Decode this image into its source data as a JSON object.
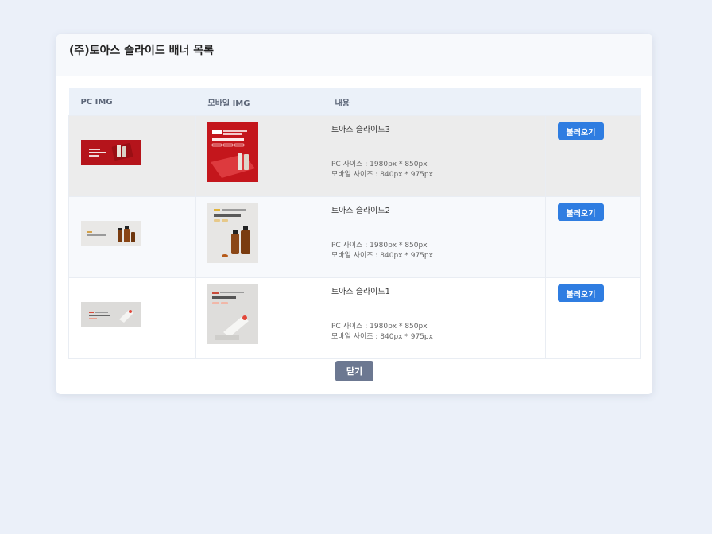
{
  "modal": {
    "title": "(주)토아스 슬라이드 배너 목록",
    "close_label": "닫기"
  },
  "table": {
    "headers": [
      "PC IMG",
      "모바일 IMG",
      "내용",
      ""
    ],
    "rows": [
      {
        "name": "토아스 슬라이드3",
        "pc_size": "PC 사이즈 : 1980px * 850px",
        "mobile_size": "모바일 사이즈 : 840px * 975px",
        "button": "불러오기"
      },
      {
        "name": "토아스 슬라이드2",
        "pc_size": "PC 사이즈 : 1980px * 850px",
        "mobile_size": "모바일 사이즈 : 840px * 975px",
        "button": "불러오기"
      },
      {
        "name": "토아스 슬라이드1",
        "pc_size": "PC 사이즈 : 1980px * 850px",
        "mobile_size": "모바일 사이즈 : 840px * 975px",
        "button": "불러오기"
      }
    ]
  },
  "colors": {
    "background": "#ebf0f9",
    "primary_button": "#2f7de1",
    "close_button": "#6c7891"
  }
}
